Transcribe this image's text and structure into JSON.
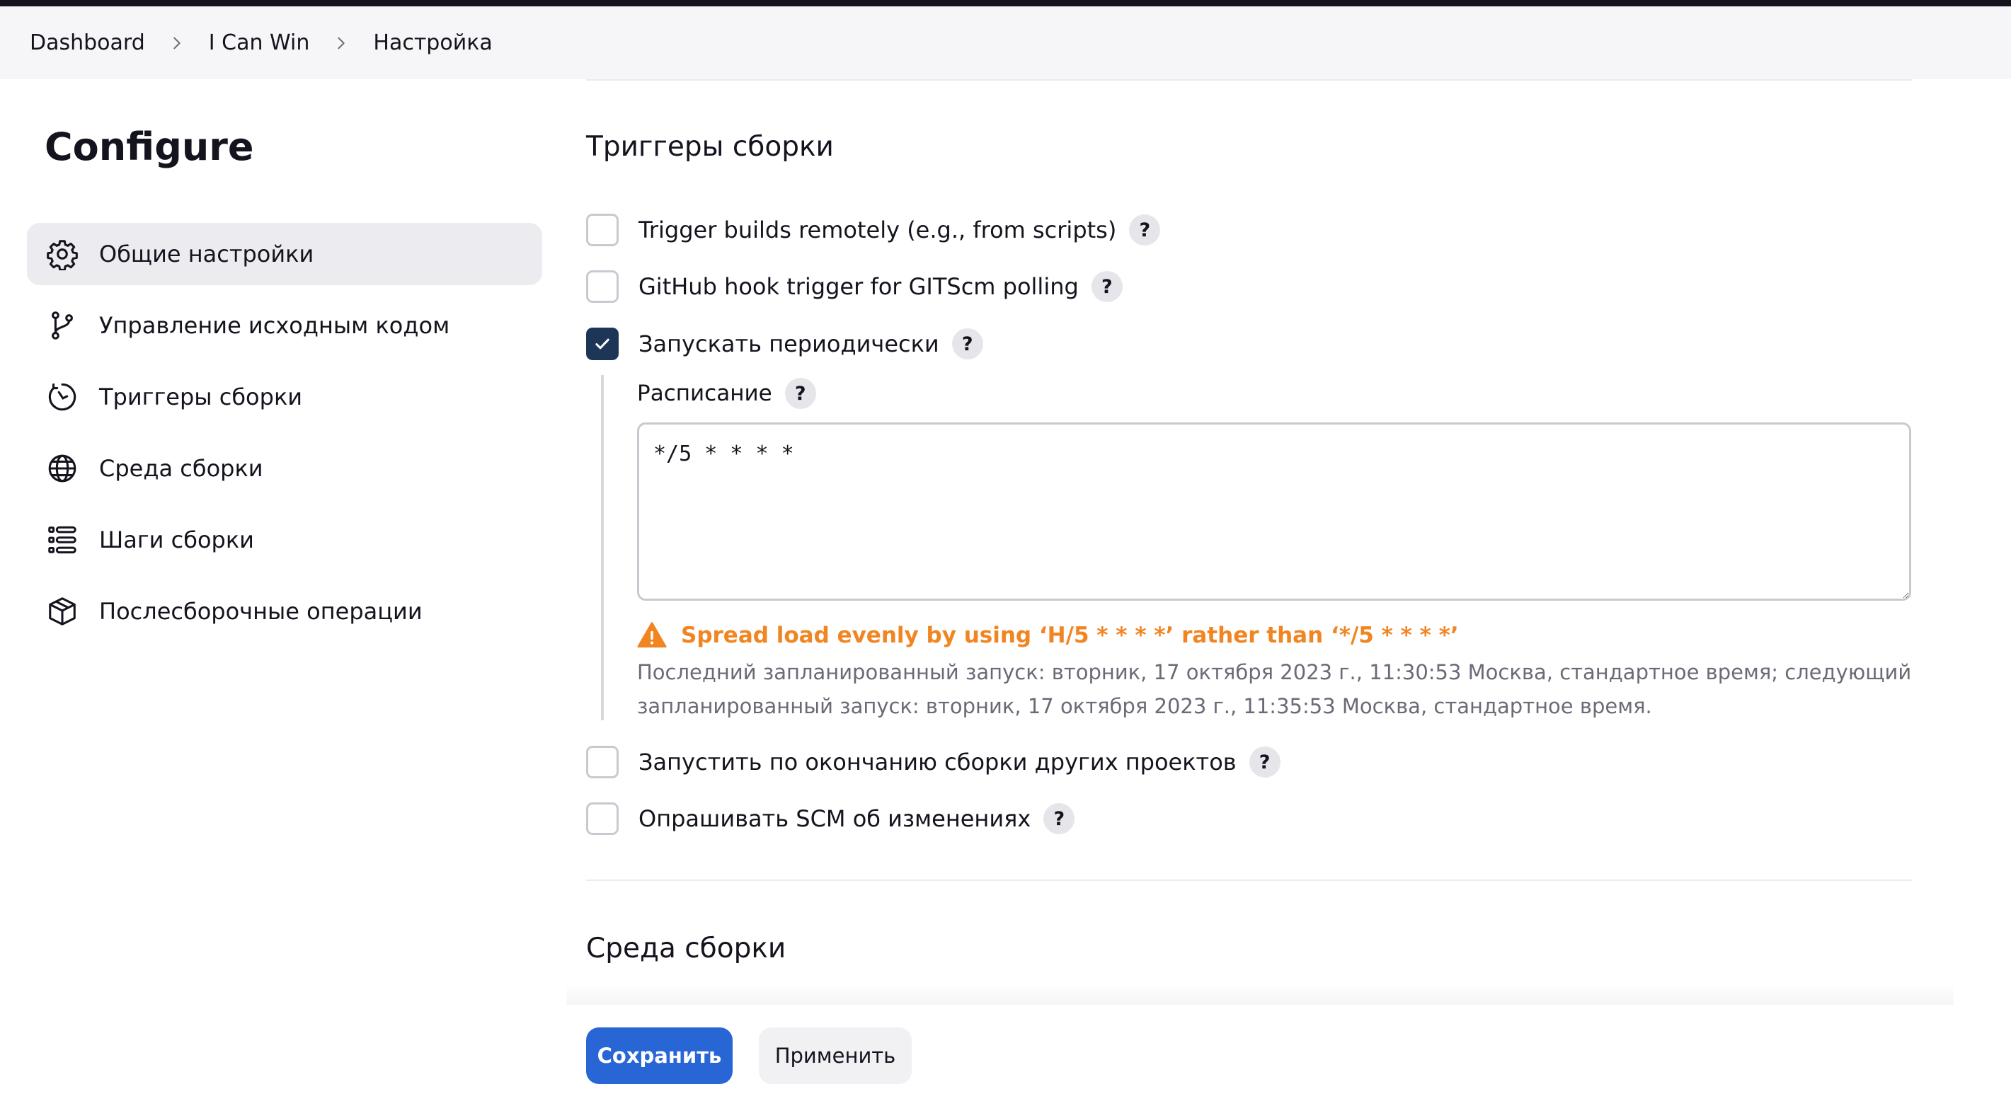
{
  "breadcrumb": [
    "Dashboard",
    "I Can Win",
    "Настройка"
  ],
  "page_title": "Configure",
  "sidebar": {
    "items": [
      {
        "label": "Общие настройки",
        "icon": "gear-icon",
        "active": true
      },
      {
        "label": "Управление исходным кодом",
        "icon": "source-branch-icon"
      },
      {
        "label": "Триггеры сборки",
        "icon": "clock-icon"
      },
      {
        "label": "Среда сборки",
        "icon": "globe-icon"
      },
      {
        "label": "Шаги сборки",
        "icon": "list-steps-icon"
      },
      {
        "label": "Послесборочные операции",
        "icon": "package-icon"
      }
    ]
  },
  "triggers": {
    "title": "Триггеры сборки",
    "options": [
      {
        "label": "Trigger builds remotely (e.g., from scripts)",
        "checked": false
      },
      {
        "label": "GitHub hook trigger for GITScm polling",
        "checked": false
      },
      {
        "label": "Запускать периодически",
        "checked": true
      },
      {
        "label": "Запустить по окончанию сборки других проектов",
        "checked": false
      },
      {
        "label": "Опрашивать SCM об изменениях",
        "checked": false
      }
    ],
    "help_symbol": "?",
    "schedule": {
      "label": "Расписание",
      "value": "*/5 * * * *",
      "warning": "Spread load evenly by using ‘H/5 * * * *’ rather than ‘*/5 * * * *’",
      "info": "Последний запланированный запуск: вторник, 17 октября 2023 г., 11:30:53 Москва, стандартное время; следующий запланированный запуск: вторник, 17 октября 2023 г., 11:35:53 Москва, стандартное время."
    }
  },
  "build_env": {
    "title": "Среда сборки"
  },
  "footer": {
    "save_label": "Сохранить",
    "apply_label": "Применить"
  },
  "colors": {
    "primary": "#2866d6",
    "checked": "#1d3658",
    "warning": "#f08521"
  }
}
